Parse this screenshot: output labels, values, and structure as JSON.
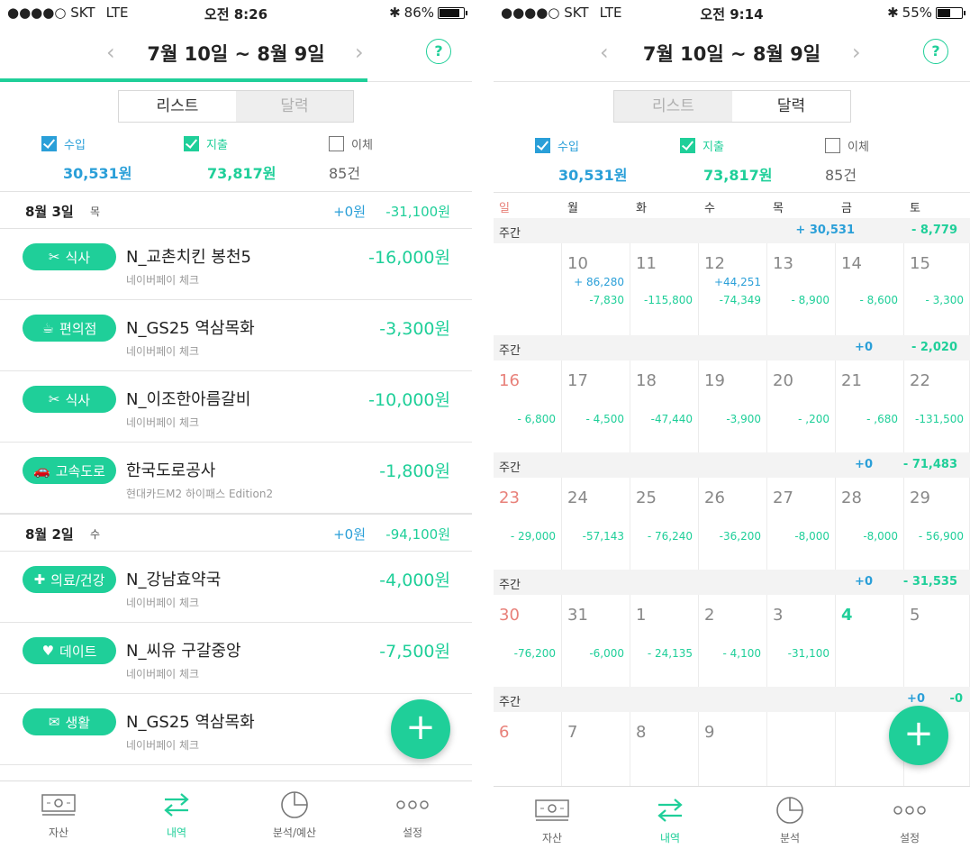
{
  "left": {
    "status": {
      "carrier": "●●●●○ SKT",
      "network": "LTE",
      "time": "오전 8:26",
      "battery": "86%"
    },
    "header": {
      "title": "7월 10일 ~ 8월 9일",
      "prev": "‹",
      "next": "›",
      "help": "?"
    },
    "segment": {
      "list": "리스트",
      "calendar": "달력"
    },
    "filters": {
      "income_label": "수입",
      "income_amount": "30,531원",
      "expense_label": "지출",
      "expense_amount": "73,817원",
      "transfer_label": "이체",
      "transfer_count": "85건"
    },
    "days": [
      {
        "date": "8월 3일",
        "weekday": "목",
        "income": "+0원",
        "expense": "-31,100원",
        "items": [
          {
            "category": "식사",
            "icon": "fork-knife-icon",
            "name": "N_교촌치킨 봉천5",
            "method": "네이버페이 체크",
            "amount": "-16,000원"
          },
          {
            "category": "편의점",
            "icon": "coffee-cup-icon",
            "name": "N_GS25 역삼목화",
            "method": "네이버페이 체크",
            "amount": "-3,300원"
          },
          {
            "category": "식사",
            "icon": "fork-knife-icon",
            "name": "N_이조한아름갈비",
            "method": "네이버페이 체크",
            "amount": "-10,000원"
          },
          {
            "category": "고속도로",
            "icon": "car-icon",
            "name": "한국도로공사",
            "method": "현대카드M2 하이패스 Edition2",
            "amount": "-1,800원"
          }
        ]
      },
      {
        "date": "8월 2일",
        "weekday": "수",
        "income": "+0원",
        "expense": "-94,100원",
        "items": [
          {
            "category": "의료/건강",
            "icon": "medical-icon",
            "name": "N_강남효약국",
            "method": "네이버페이 체크",
            "amount": "-4,000원"
          },
          {
            "category": "데이트",
            "icon": "heart-icon",
            "name": "N_씨유 구갈중앙",
            "method": "네이버페이 체크",
            "amount": "-7,500원"
          },
          {
            "category": "생활",
            "icon": "envelope-icon",
            "name": "N_GS25 역삼목화",
            "method": "네이버페이 체크",
            "amount": ""
          }
        ]
      }
    ],
    "tabs": [
      {
        "label": "자산",
        "icon": "money-icon"
      },
      {
        "label": "내역",
        "icon": "transfer-arrows-icon"
      },
      {
        "label": "분석/예산",
        "icon": "pie-chart-icon"
      },
      {
        "label": "설정",
        "icon": "more-dots-icon"
      }
    ],
    "fab": "+"
  },
  "right": {
    "status": {
      "carrier": "●●●●○ SKT",
      "network": "LTE",
      "time": "오전 9:14",
      "battery": "55%"
    },
    "header": {
      "title": "7월 10일 ~ 8월 9일",
      "prev": "‹",
      "next": "›",
      "help": "?"
    },
    "segment": {
      "list": "리스트",
      "calendar": "달력"
    },
    "filters": {
      "income_label": "수입",
      "income_amount": "30,531원",
      "expense_label": "지출",
      "expense_amount": "73,817원",
      "transfer_label": "이체",
      "transfer_count": "85건"
    },
    "weekdays": [
      "일",
      "월",
      "화",
      "수",
      "목",
      "금",
      "토"
    ],
    "week_label": "주간",
    "weeks": [
      {
        "income": "+ 30,531",
        "expense": "- 8,779",
        "days": [
          {
            "d": "",
            "i": "",
            "e": ""
          },
          {
            "d": "10",
            "i": "+ 86,280",
            "e": "-7,830"
          },
          {
            "d": "11",
            "i": "",
            "e": "-115,800"
          },
          {
            "d": "12",
            "i": "+44,251",
            "e": "-74,349"
          },
          {
            "d": "13",
            "i": "",
            "e": "- 8,900"
          },
          {
            "d": "14",
            "i": "",
            "e": "- 8,600"
          },
          {
            "d": "15",
            "i": "",
            "e": "- 3,300"
          }
        ]
      },
      {
        "income": "+0",
        "expense": "- 2,020",
        "days": [
          {
            "d": "16",
            "i": "",
            "e": "- 6,800"
          },
          {
            "d": "17",
            "i": "",
            "e": "- 4,500"
          },
          {
            "d": "18",
            "i": "",
            "e": "-47,440"
          },
          {
            "d": "19",
            "i": "",
            "e": "-3,900"
          },
          {
            "d": "20",
            "i": "",
            "e": "- ,200"
          },
          {
            "d": "21",
            "i": "",
            "e": "- ,680"
          },
          {
            "d": "22",
            "i": "",
            "e": "-131,500"
          }
        ]
      },
      {
        "income": "+0",
        "expense": "- 71,483",
        "days": [
          {
            "d": "23",
            "i": "",
            "e": "- 29,000"
          },
          {
            "d": "24",
            "i": "",
            "e": "-57,143"
          },
          {
            "d": "25",
            "i": "",
            "e": "- 76,240"
          },
          {
            "d": "26",
            "i": "",
            "e": "-36,200"
          },
          {
            "d": "27",
            "i": "",
            "e": "-8,000"
          },
          {
            "d": "28",
            "i": "",
            "e": "-8,000"
          },
          {
            "d": "29",
            "i": "",
            "e": "- 56,900"
          }
        ]
      },
      {
        "income": "+0",
        "expense": "- 31,535",
        "days": [
          {
            "d": "30",
            "i": "",
            "e": "-76,200"
          },
          {
            "d": "31",
            "i": "",
            "e": "-6,000"
          },
          {
            "d": "1",
            "i": "",
            "e": "- 24,135"
          },
          {
            "d": "2",
            "i": "",
            "e": "- 4,100"
          },
          {
            "d": "3",
            "i": "",
            "e": "-31,100"
          },
          {
            "d": "4",
            "i": "",
            "e": ""
          },
          {
            "d": "5",
            "i": "",
            "e": ""
          }
        ]
      },
      {
        "income": "+0",
        "expense": "-0",
        "days": [
          {
            "d": "6",
            "i": "",
            "e": ""
          },
          {
            "d": "7",
            "i": "",
            "e": ""
          },
          {
            "d": "8",
            "i": "",
            "e": ""
          },
          {
            "d": "9",
            "i": "",
            "e": ""
          },
          {
            "d": "",
            "i": "",
            "e": ""
          },
          {
            "d": "",
            "i": "",
            "e": ""
          },
          {
            "d": "",
            "i": "",
            "e": ""
          }
        ]
      }
    ],
    "today": "4",
    "tabs": [
      {
        "label": "자산",
        "icon": "money-icon"
      },
      {
        "label": "내역",
        "icon": "transfer-arrows-icon"
      },
      {
        "label": "분석",
        "icon": "pie-chart-icon"
      },
      {
        "label": "설정",
        "icon": "more-dots-icon"
      }
    ],
    "fab": "+",
    "colors": {
      "accent": "#1fcf99",
      "income": "#2a9fd8",
      "sunday": "#e8817a"
    }
  }
}
